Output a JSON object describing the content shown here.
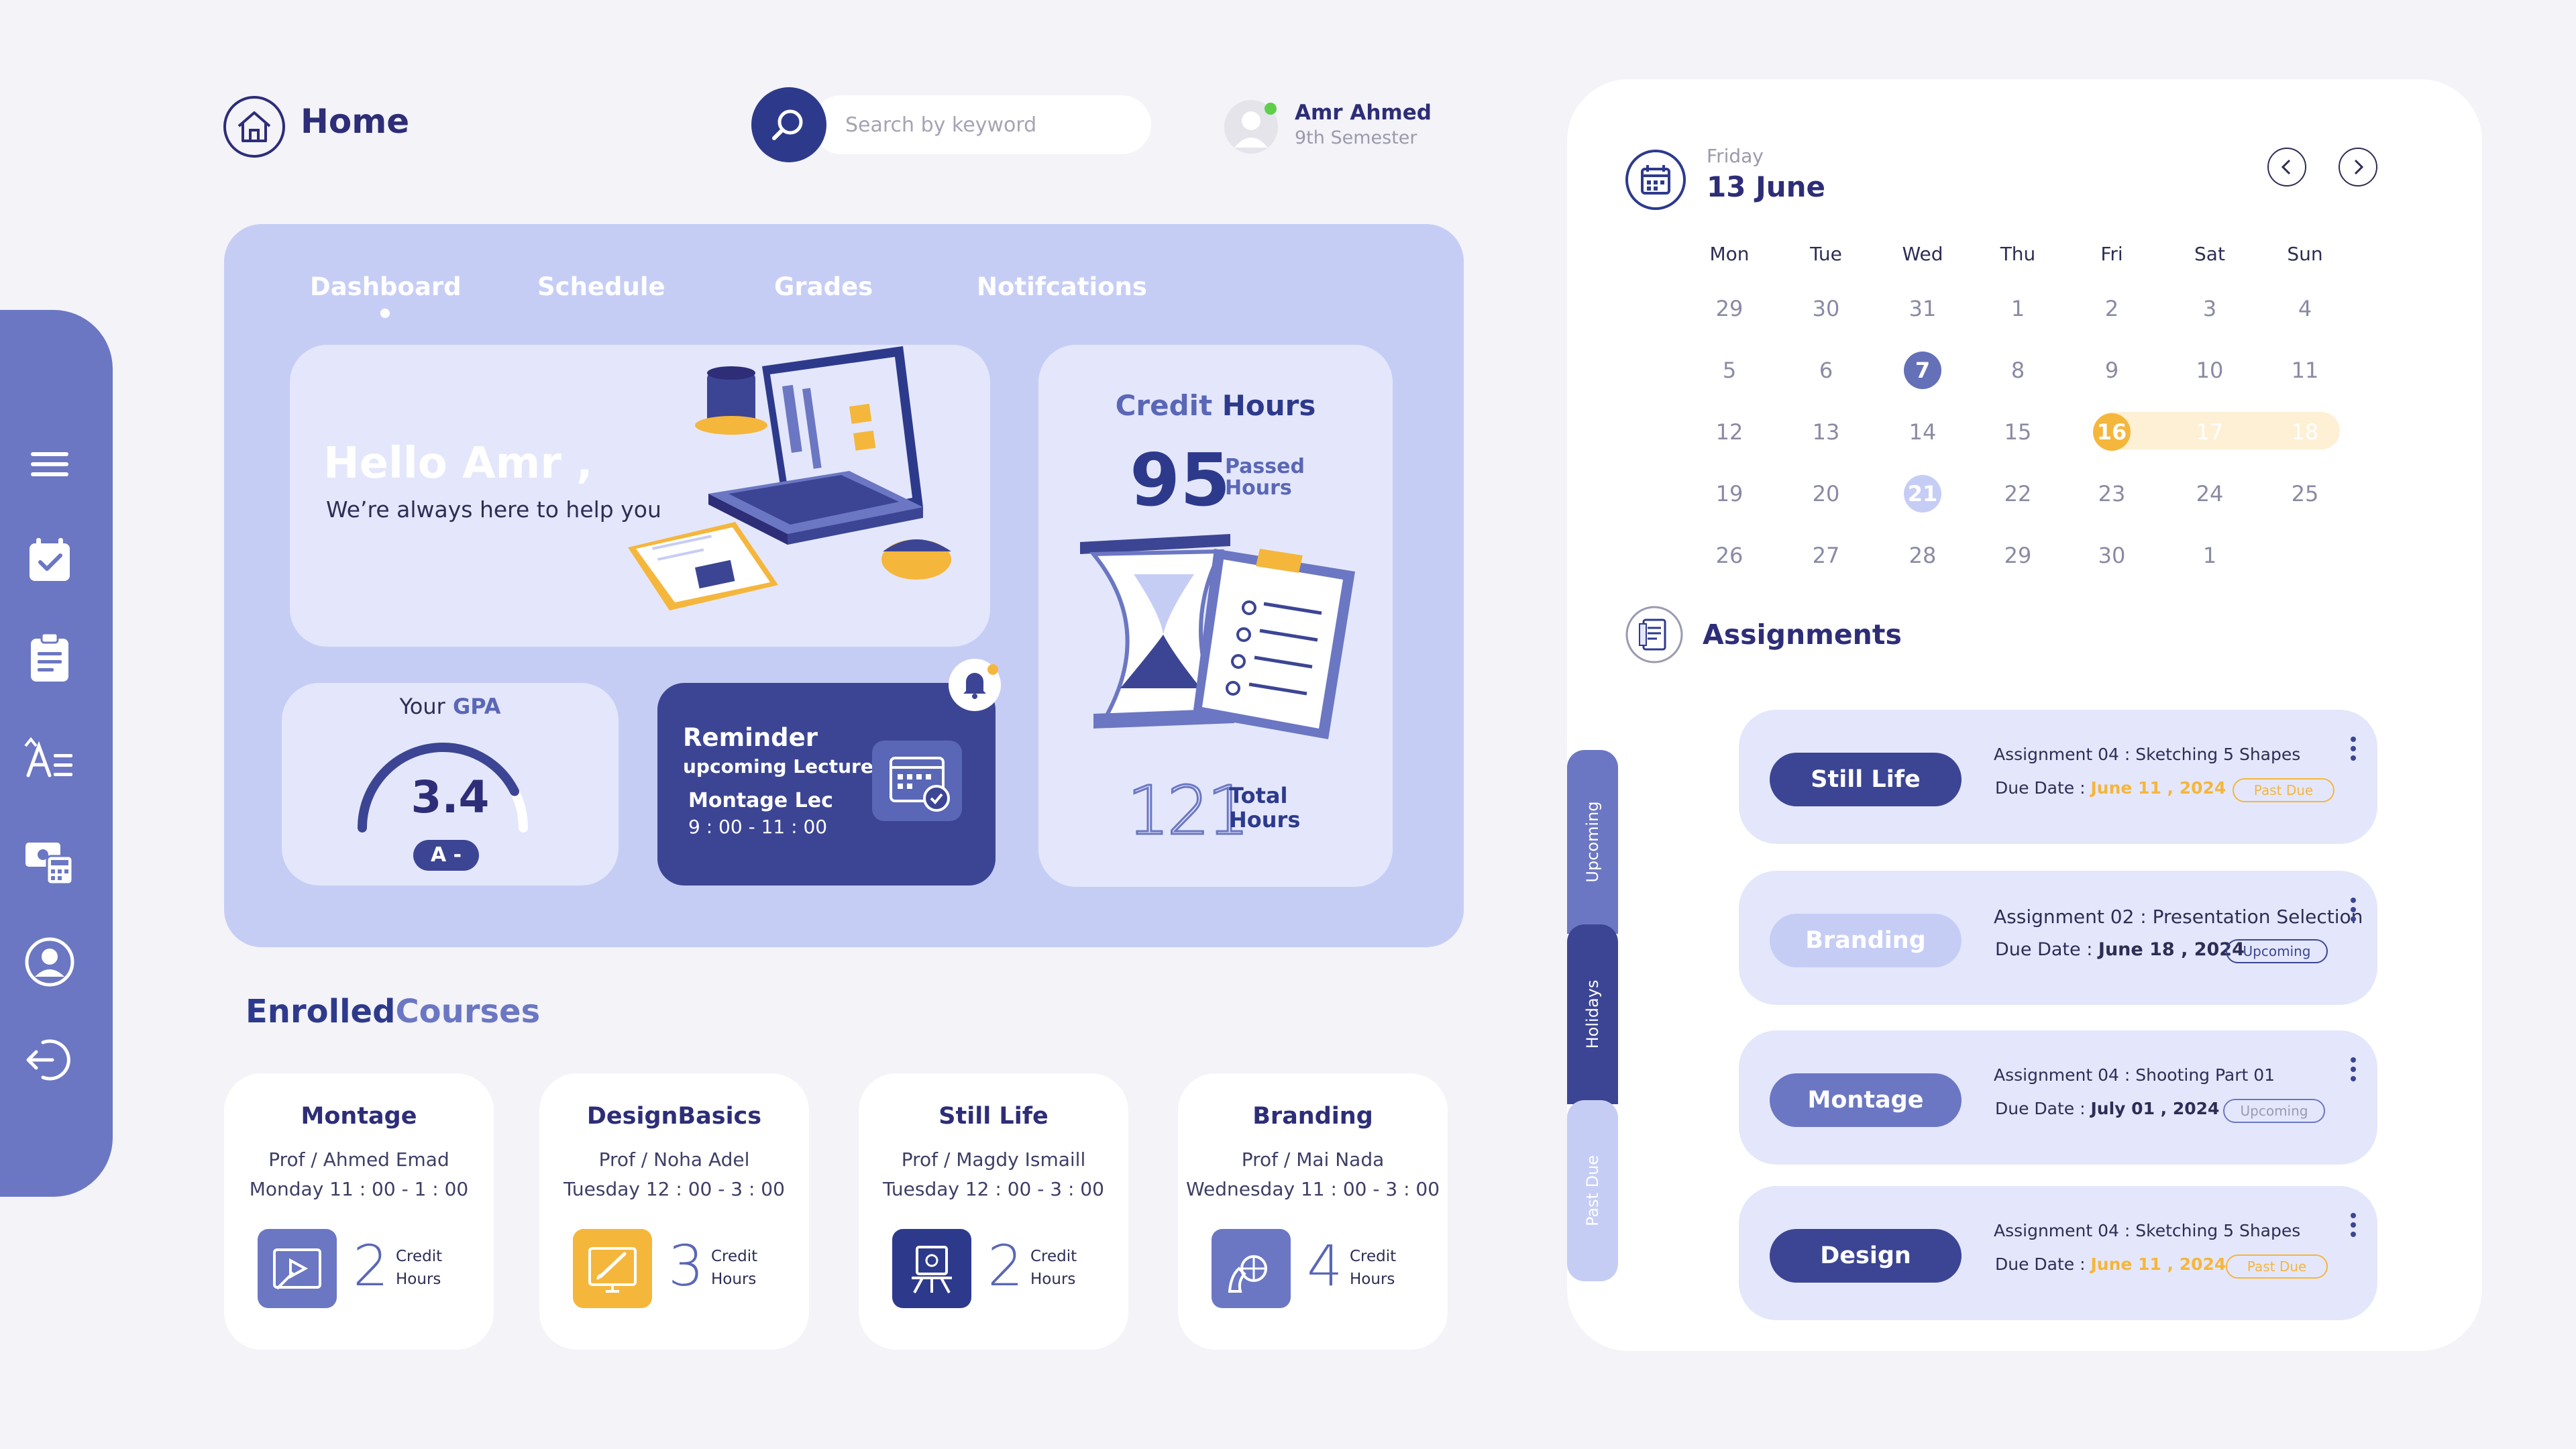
{
  "header": {
    "title": "Home",
    "search_placeholder": "Search by keyword",
    "user_name": "Amr Ahmed",
    "user_semester": "9th Semester"
  },
  "sidebar": {
    "items": [
      {
        "icon": "menu-icon"
      },
      {
        "icon": "calendar-check-icon"
      },
      {
        "icon": "clipboard-icon"
      },
      {
        "icon": "grades-icon"
      },
      {
        "icon": "payments-icon"
      },
      {
        "icon": "profile-icon"
      },
      {
        "icon": "logout-icon"
      }
    ]
  },
  "tabs": [
    {
      "label": "Dashboard"
    },
    {
      "label": "Schedule"
    },
    {
      "label": "Grades"
    },
    {
      "label": "Notifcations"
    }
  ],
  "hello": {
    "title": "Hello Amr ,",
    "subtitle": "We’re always here to help you"
  },
  "credit_hours": {
    "title_light": "Credit",
    "title_bold": " Hours",
    "passed": "95",
    "passed_label": "Passed Hours",
    "total": "121",
    "total_label": "Total Hours"
  },
  "gpa": {
    "label_prefix": "Your",
    "label_bold": " GPA",
    "value": "3.4",
    "grade": "A -",
    "gauge_fraction": 0.85
  },
  "reminder": {
    "title": "Reminder",
    "subtitle": "upcoming Lecture",
    "lecture": "Montage Lec",
    "time": "9 : 00 - 11 : 00"
  },
  "courses": {
    "title_bold": "Enrolled",
    "title_light": "Courses",
    "items": [
      {
        "name": "Montage",
        "prof": "Prof / Ahmed Emad",
        "time": "Monday 11 : 00 - 1 : 00",
        "credits": "2",
        "credit_label": "Credit Hours",
        "icon": "video-edit-icon",
        "color": "#6b77c2"
      },
      {
        "name": "DesignBasics",
        "prof": "Prof / Noha Adel",
        "time": "Tuesday 12 : 00 - 3 : 00",
        "credits": "3",
        "credit_label": "Credit Hours",
        "icon": "design-icon",
        "color": "#f5b63c"
      },
      {
        "name": "Still Life",
        "prof": "Prof / Magdy Ismaill",
        "time": "Tuesday 12 : 00 - 3 : 00",
        "credits": "2",
        "credit_label": "Credit Hours",
        "icon": "easel-icon",
        "color": "#2d3a8c"
      },
      {
        "name": "Branding",
        "prof": "Prof / Mai Nada",
        "time": "Wednesday 11 : 00 - 3 : 00",
        "credits": "4",
        "credit_label": "Credit Hours",
        "icon": "branding-icon",
        "color": "#6b77c2"
      }
    ]
  },
  "calendar": {
    "day_name": "Friday",
    "date": "13  June",
    "weekdays": [
      "Mon",
      "Tue",
      "Wed",
      "Thu",
      "Fri",
      "Sat",
      "Sun"
    ],
    "weeks": [
      [
        "29",
        "30",
        "31",
        "1",
        "2",
        "3",
        "4"
      ],
      [
        "5",
        "6",
        "7",
        "8",
        "9",
        "10",
        "11"
      ],
      [
        "12",
        "13",
        "14",
        "15",
        "16",
        "17",
        "18"
      ],
      [
        "19",
        "20",
        "21",
        "22",
        "23",
        "24",
        "25"
      ],
      [
        "26",
        "27",
        "28",
        "29",
        "30",
        "1",
        ""
      ]
    ],
    "selected_day": "7",
    "highlight_day": "21",
    "range": [
      "16",
      "17",
      "18"
    ]
  },
  "assignments": {
    "title": "Assignments",
    "side_tabs": [
      "Upcoming",
      "Holidays",
      "Past Due"
    ],
    "items": [
      {
        "course": "Still Life",
        "title": "Assignment 04 : Sketching 5 Shapes",
        "due_label": "Due Date :",
        "due_date": "June 11 , 2024",
        "status": "Past Due",
        "pill_color": "#3c4594"
      },
      {
        "course": "Branding",
        "title": "Assignment 02 : Presentation Selection",
        "due_label": "Due Date :",
        "due_date": "June 18 , 2024",
        "status": "Upcoming",
        "pill_color": "#c6cdf5"
      },
      {
        "course": "Montage",
        "title": "Assignment 04 : Shooting Part 01",
        "due_label": "Due Date :",
        "due_date": "July 01 , 2024",
        "status": "Upcoming",
        "pill_color": "#6b77c2"
      },
      {
        "course": "Design",
        "title": "Assignment 04 : Sketching 5 Shapes",
        "due_label": "Due Date :",
        "due_date": "June 11 , 2024",
        "status": "Past Due",
        "pill_color": "#3c4594"
      }
    ]
  }
}
